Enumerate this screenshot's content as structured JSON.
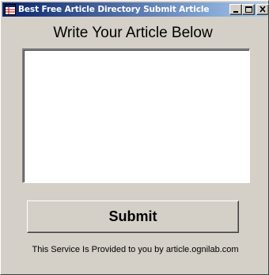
{
  "window": {
    "title": "Best Free Article Directory Submit Article",
    "controls": [
      "minimize-icon",
      "maximize-icon",
      "close-icon"
    ]
  },
  "main": {
    "heading": "Write Your Article Below",
    "article_value": "",
    "submit_label": "Submit",
    "footer": "This Service Is Provided to you by article.ognilab.com"
  },
  "colors": {
    "titlebar_start": "#0a246a",
    "titlebar_end": "#a6caf0",
    "face": "#d4d0c8"
  }
}
